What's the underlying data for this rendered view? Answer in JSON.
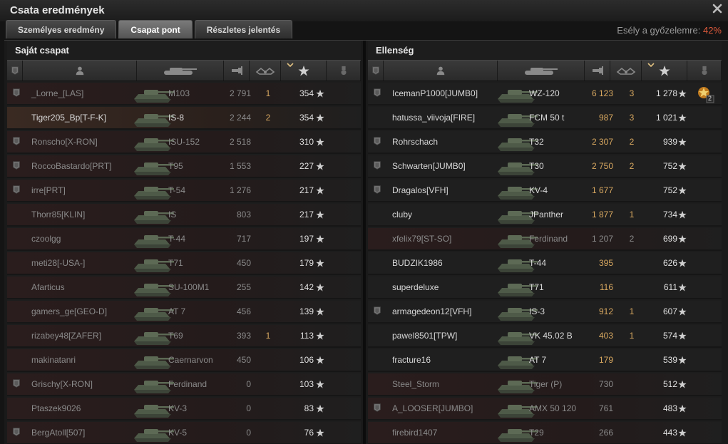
{
  "window": {
    "title": "Csata eredmények",
    "close_icon": "close-icon"
  },
  "tabs": [
    {
      "label": "Személyes eredmény",
      "active": false
    },
    {
      "label": "Csapat pont",
      "active": true
    },
    {
      "label": "Részletes jelentés",
      "active": false
    }
  ],
  "win_chance": {
    "label": "Esély a győzelemre: ",
    "value": "42%"
  },
  "columns": [
    "badge-icon",
    "player-icon",
    "tank-icon",
    "damage-icon",
    "kills-icon",
    "xp-star-icon",
    "medal-icon"
  ],
  "left": {
    "title": "Saját csapat",
    "rows": [
      {
        "badge": true,
        "name": "_Lorne_[LAS]",
        "tank": "M103",
        "damage": "2 791",
        "kills": "1",
        "xp": "354",
        "state": "dead"
      },
      {
        "badge": false,
        "name": "Tiger205_Bp[T-F-K]",
        "tank": "IS-8",
        "damage": "2 244",
        "kills": "2",
        "xp": "354",
        "state": "self"
      },
      {
        "badge": true,
        "name": "Ronscho[X-RON]",
        "tank": "ISU-152",
        "damage": "2 518",
        "kills": "",
        "xp": "310",
        "state": "dead"
      },
      {
        "badge": true,
        "name": "RoccoBastardo[PRT]",
        "tank": "T95",
        "damage": "1 553",
        "kills": "",
        "xp": "227",
        "state": "dead"
      },
      {
        "badge": true,
        "name": "irre[PRT]",
        "tank": "T-54",
        "damage": "1 276",
        "kills": "",
        "xp": "217",
        "state": "dead"
      },
      {
        "badge": false,
        "name": "Thorr85[KLIN]",
        "tank": "IS",
        "damage": "803",
        "kills": "",
        "xp": "217",
        "state": "dead"
      },
      {
        "badge": false,
        "name": "czoolgg",
        "tank": "T-44",
        "damage": "717",
        "kills": "",
        "xp": "197",
        "state": "dead"
      },
      {
        "badge": false,
        "name": "meti28[-USA-]",
        "tank": "T71",
        "damage": "450",
        "kills": "",
        "xp": "179",
        "state": "dead"
      },
      {
        "badge": false,
        "name": "Afarticus",
        "tank": "SU-100M1",
        "damage": "255",
        "kills": "",
        "xp": "142",
        "state": "dead"
      },
      {
        "badge": false,
        "name": "gamers_ge[GEO-D]",
        "tank": "AT 7",
        "damage": "456",
        "kills": "",
        "xp": "139",
        "state": "dead"
      },
      {
        "badge": false,
        "name": "rizabey48[ZAFER]",
        "tank": "T69",
        "damage": "393",
        "kills": "1",
        "xp": "113",
        "state": "dead"
      },
      {
        "badge": false,
        "name": "makinatanri",
        "tank": "Caernarvon",
        "damage": "450",
        "kills": "",
        "xp": "106",
        "state": "dead"
      },
      {
        "badge": true,
        "name": "Grischy[X-RON]",
        "tank": "Ferdinand",
        "damage": "0",
        "kills": "",
        "xp": "103",
        "state": "dead"
      },
      {
        "badge": false,
        "name": "Ptaszek9026",
        "tank": "KV-3",
        "damage": "0",
        "kills": "",
        "xp": "83",
        "state": "dead"
      },
      {
        "badge": true,
        "name": "BergAtoll[507]",
        "tank": "KV-5",
        "damage": "0",
        "kills": "",
        "xp": "76",
        "state": "dead"
      }
    ]
  },
  "right": {
    "title": "Ellenség",
    "rows": [
      {
        "badge": true,
        "name": "IcemanP1000[JUMB0]",
        "tank": "WZ-120",
        "damage": "6 123",
        "kills": "3",
        "xp": "1 278",
        "state": "alive",
        "medal": "2"
      },
      {
        "badge": false,
        "name": "hatussa_viivoja[FIRE]",
        "tank": "FCM 50 t",
        "damage": "987",
        "kills": "3",
        "xp": "1 021",
        "state": "alive"
      },
      {
        "badge": true,
        "name": "Rohrschach",
        "tank": "T32",
        "damage": "2 307",
        "kills": "2",
        "xp": "939",
        "state": "alive"
      },
      {
        "badge": true,
        "name": "Schwarten[JUMB0]",
        "tank": "T30",
        "damage": "2 750",
        "kills": "2",
        "xp": "752",
        "state": "alive"
      },
      {
        "badge": true,
        "name": "Dragalos[VFH]",
        "tank": "KV-4",
        "damage": "1 677",
        "kills": "",
        "xp": "752",
        "state": "alive"
      },
      {
        "badge": false,
        "name": "cluby",
        "tank": "JPanther",
        "damage": "1 877",
        "kills": "1",
        "xp": "734",
        "state": "alive"
      },
      {
        "badge": false,
        "name": "xfelix79[ST-SO]",
        "tank": "Ferdinand",
        "damage": "1 207",
        "kills": "2",
        "xp": "699",
        "state": "dead"
      },
      {
        "badge": false,
        "name": "BUDZIK1986",
        "tank": "T-44",
        "damage": "395",
        "kills": "",
        "xp": "626",
        "state": "alive"
      },
      {
        "badge": false,
        "name": "superdeluxe",
        "tank": "T71",
        "damage": "116",
        "kills": "",
        "xp": "611",
        "state": "alive"
      },
      {
        "badge": true,
        "name": "armagedeon12[VFH]",
        "tank": "IS-3",
        "damage": "912",
        "kills": "1",
        "xp": "607",
        "state": "alive"
      },
      {
        "badge": false,
        "name": "pawel8501[TPW]",
        "tank": "VK 45.02 B",
        "damage": "403",
        "kills": "1",
        "xp": "574",
        "state": "alive"
      },
      {
        "badge": false,
        "name": "fracture16",
        "tank": "AT 7",
        "damage": "179",
        "kills": "",
        "xp": "539",
        "state": "alive"
      },
      {
        "badge": false,
        "name": "Steel_Storm",
        "tank": "Tiger (P)",
        "damage": "730",
        "kills": "",
        "xp": "512",
        "state": "dead"
      },
      {
        "badge": true,
        "name": "A_LOOSER[JUMBO]",
        "tank": "AMX 50 120",
        "damage": "761",
        "kills": "",
        "xp": "483",
        "state": "dead"
      },
      {
        "badge": false,
        "name": "firebird1407",
        "tank": "T29",
        "damage": "266",
        "kills": "",
        "xp": "443",
        "state": "dead"
      }
    ]
  }
}
